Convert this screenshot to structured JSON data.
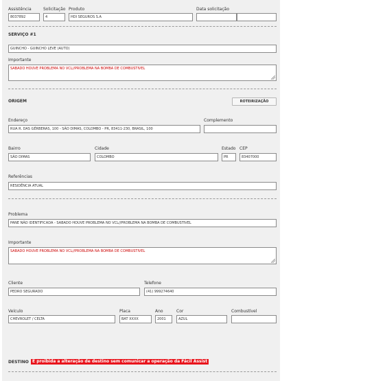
{
  "header": {
    "assistencia_label": "Assistência",
    "assistencia_value": "8037892",
    "solicitacao_label": "Solicitação",
    "solicitacao_value": "4",
    "produto_label": "Produto",
    "produto_value": "HDI SEGUROS S.A",
    "data_label": "Data solicitação",
    "data_value": "",
    "time_value": ""
  },
  "servico": {
    "title": "SERVIÇO #1",
    "tipo_value": "GUINCHO - GUINCHO LEVE (AUTO)",
    "importante_label": "Importante",
    "importante_value": "SABADO HOUVE PROBLEMA NO VCL//PROBLEMA NA BOMBA DE COMBUSTIVEL"
  },
  "origem": {
    "title": "ORIGEM",
    "roteirizacao_label": "ROTEIRIZAÇÃO",
    "endereco_label": "Endereço",
    "endereco_value": "RUA R. DAS GÉRBERAS, 100 - SÃO DIMAS, COLOMBO - PR, 83411-230, BRASIL, 100",
    "complemento_label": "Complemento",
    "complemento_value": "",
    "bairro_label": "Bairro",
    "bairro_value": "SÃO DIMAS",
    "cidade_label": "Cidade",
    "cidade_value": "COLOMBO",
    "estado_label": "Estado",
    "estado_value": "PR",
    "cep_label": "CEP",
    "cep_value": "83407000",
    "referencias_label": "Referências",
    "referencias_value": "RESIDÊNCIA ATUAL"
  },
  "problema": {
    "problema_label": "Problema",
    "problema_value": "PANE NÃO IDENTIFICADA - SABADO HOUVE PROBLEMA NO VCL//PROBLEMA NA BOMBA DE COMBUSTIVEL",
    "importante_label": "Importante",
    "importante_value": "SABADO HOUVE PROBLEMA NO VCL//PROBLEMA NA BOMBA DE COMBUSTIVEL"
  },
  "cliente": {
    "cliente_label": "Cliente",
    "cliente_value": "PEDRO SEGURADO",
    "telefone_label": "Telefone",
    "telefone_value": "(41) 999274640"
  },
  "veiculo": {
    "veiculo_label": "Veículo",
    "veiculo_value": "CHEVROLET / CELTA",
    "placa_label": "Placa",
    "placa_value": "BAT XXXX",
    "ano_label": "Ano",
    "ano_value": "2001",
    "cor_label": "Cor",
    "cor_value": "AZUL",
    "combustivel_label": "Combustível",
    "combustivel_value": ""
  },
  "destino": {
    "title": "DESTINO",
    "warning": "É proibida a alteração de destino sem comunicar a operação da Fácil Assist"
  },
  "colors": {
    "panel": "#f0f0f0",
    "warning_bg": "#e8141c",
    "important_text": "#cc0000"
  }
}
